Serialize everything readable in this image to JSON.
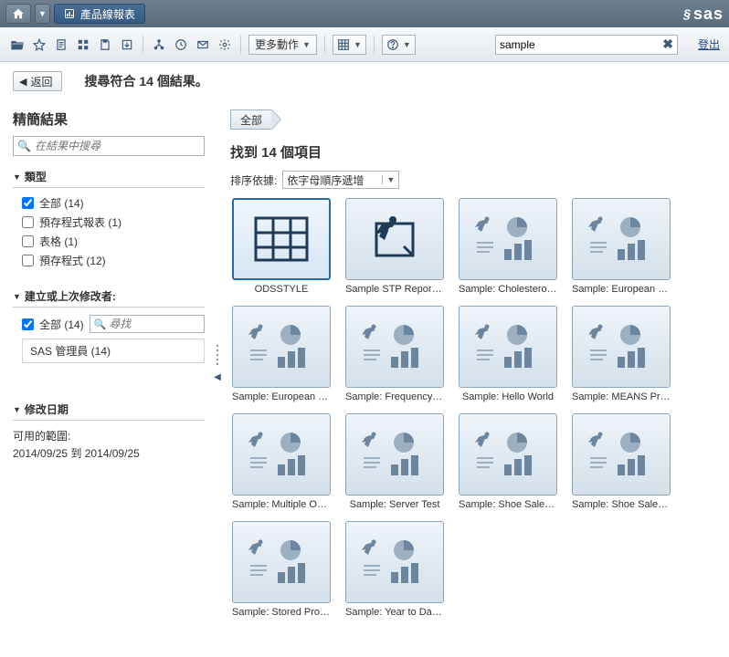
{
  "titlebar": {
    "breadcrumb_label": "產品線報表"
  },
  "toolbar": {
    "more_actions": "更多動作",
    "search_value": "sample",
    "logout": "登出"
  },
  "backrow": {
    "back_label": "返回",
    "result_title": "搜尋符合 14 個結果。"
  },
  "sidebar": {
    "title": "精簡結果",
    "search_placeholder": "在結果中搜尋",
    "sections": {
      "type_title": "類型",
      "type_items": [
        {
          "label": "全部 (14)",
          "checked": true
        },
        {
          "label": "預存程式報表 (1)",
          "checked": false
        },
        {
          "label": "表格 (1)",
          "checked": false
        },
        {
          "label": "預存程式 (12)",
          "checked": false
        }
      ],
      "author_title": "建立或上次修改者:",
      "author_all_label": "全部 (14)",
      "author_search_placeholder": "尋找",
      "author_item": "SAS 管理員 (14)",
      "date_title": "修改日期",
      "date_range_label": "可用的範圍:",
      "date_range_value": "2014/09/25 到 2014/09/25"
    }
  },
  "content": {
    "bc_all": "全部",
    "found": "找到 14 個項目",
    "sort_label": "排序依據:",
    "sort_value": "依字母順序遞增",
    "items": [
      {
        "label": "ODSSTYLE",
        "kind": "table",
        "selected": true
      },
      {
        "label": "Sample STP Report: ...",
        "kind": "stp"
      },
      {
        "label": "Sample: Cholesterol b...",
        "kind": "report"
      },
      {
        "label": "Sample: European De...",
        "kind": "report"
      },
      {
        "label": "Sample: European De...",
        "kind": "report"
      },
      {
        "label": "Sample: Frequency A...",
        "kind": "report"
      },
      {
        "label": "Sample: Hello World",
        "kind": "report"
      },
      {
        "label": "Sample: MEANS Pro...",
        "kind": "report"
      },
      {
        "label": "Sample: Multiple Out...",
        "kind": "report"
      },
      {
        "label": "Sample: Server Test",
        "kind": "report"
      },
      {
        "label": "Sample: Shoe Sales b...",
        "kind": "report"
      },
      {
        "label": "Sample: Shoe Sales G...",
        "kind": "report"
      },
      {
        "label": "Sample: Stored Proce...",
        "kind": "report"
      },
      {
        "label": "Sample: Year to Date ...",
        "kind": "report"
      }
    ]
  }
}
